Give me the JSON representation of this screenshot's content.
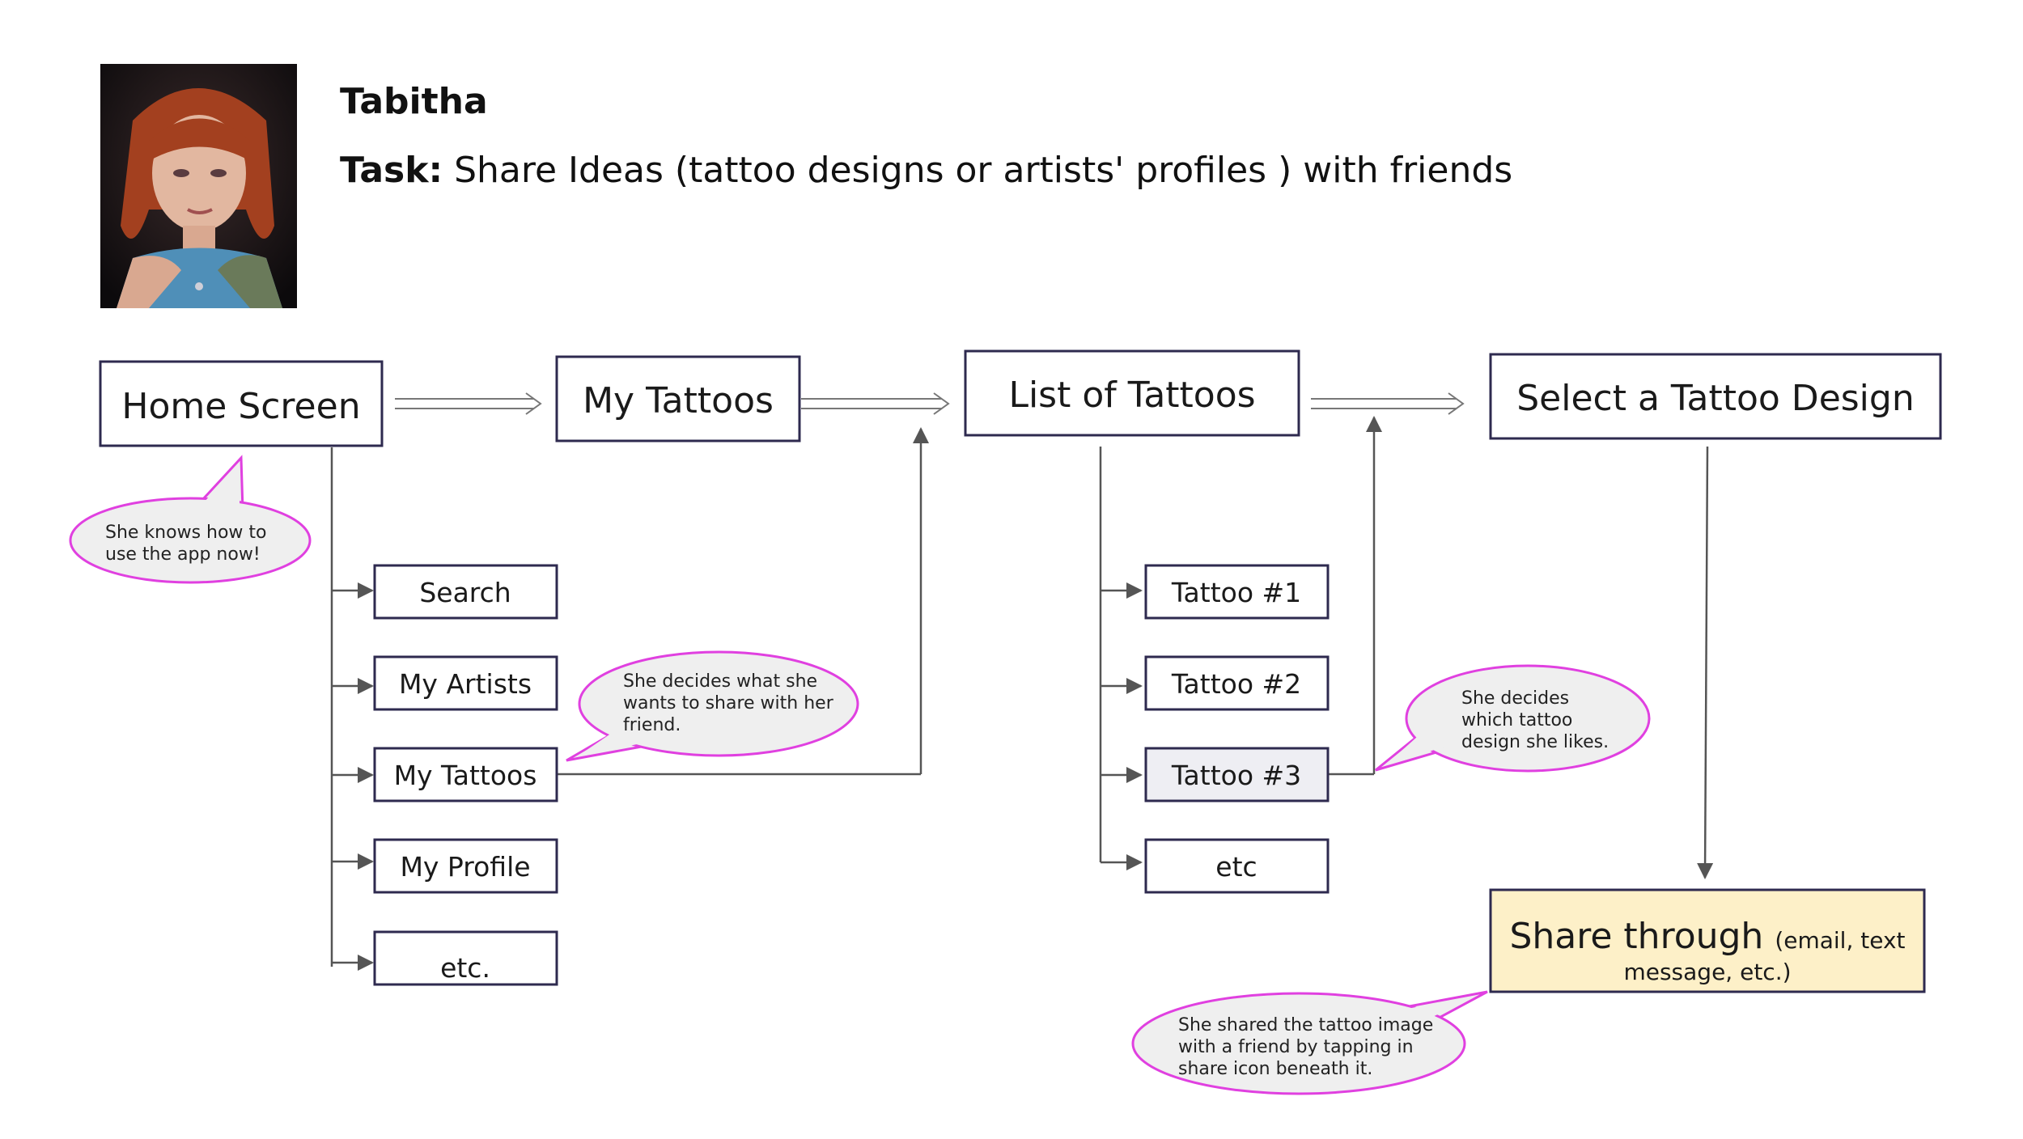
{
  "persona": {
    "name": "Tabitha",
    "task_label": "Task:",
    "task_text": "Share Ideas (tattoo designs or artists' profiles ) with friends"
  },
  "nodes": {
    "home_screen": "Home Screen",
    "my_tattoos_main": "My Tattoos",
    "list_of_tattoos": "List of Tattoos",
    "select_design": "Select a Tattoo Design",
    "search": "Search",
    "my_artists": "My Artists",
    "my_tattoos_sub": "My Tattoos",
    "my_profile": "My Profile",
    "etc_home": "etc.",
    "tattoo_1": "Tattoo #1",
    "tattoo_2": "Tattoo #2",
    "tattoo_3": "Tattoo #3",
    "etc_list": "etc",
    "share_main": "Share through",
    "share_small_1": "(email, text",
    "share_small_2": "message, etc.)"
  },
  "callouts": {
    "knows_app": [
      "She knows how to",
      "use the app now!"
    ],
    "decides_share": [
      "She decides what she",
      "wants to share with her",
      "friend."
    ],
    "decides_design": [
      "She decides",
      "which tattoo",
      "design she likes."
    ],
    "shared_image": [
      "She shared the tattoo image",
      "with a friend by tapping in",
      "share icon beneath it."
    ]
  },
  "colors": {
    "box_border": "#2e2a4f",
    "line": "#555555",
    "callout_border": "#e040e0",
    "callout_fill": "#efefef",
    "highlight_fill": "#eeeef3",
    "share_fill": "#fdf0c8"
  }
}
